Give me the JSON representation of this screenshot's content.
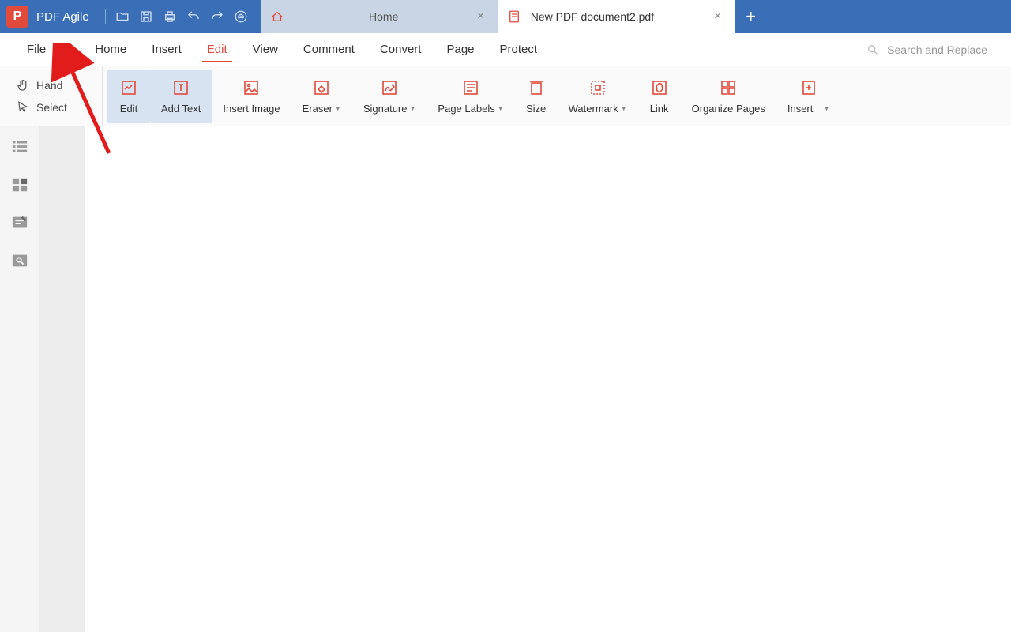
{
  "app": {
    "name": "PDF Agile",
    "logo_letter": "P"
  },
  "tabs": {
    "home": {
      "label": "Home"
    },
    "active": {
      "label": "New PDF document2.pdf"
    }
  },
  "menubar": {
    "file": "File",
    "home": "Home",
    "insert": "Insert",
    "edit": "Edit",
    "view": "View",
    "comment": "Comment",
    "convert": "Convert",
    "page": "Page",
    "protect": "Protect",
    "search_placeholder": "Search and Replace"
  },
  "left_tools": {
    "hand": "Hand",
    "select": "Select"
  },
  "ribbon": {
    "edit": "Edit",
    "add_text": "Add Text",
    "insert_image": "Insert Image",
    "eraser": "Eraser",
    "signature": "Signature",
    "page_labels": "Page Labels",
    "size": "Size",
    "watermark": "Watermark",
    "link": "Link",
    "organize": "Organize Pages",
    "insert": "Insert"
  },
  "colors": {
    "accent_red": "#e24a3b",
    "titlebar_blue": "#3a6fb7",
    "selected_bg": "#d8e3f2"
  }
}
